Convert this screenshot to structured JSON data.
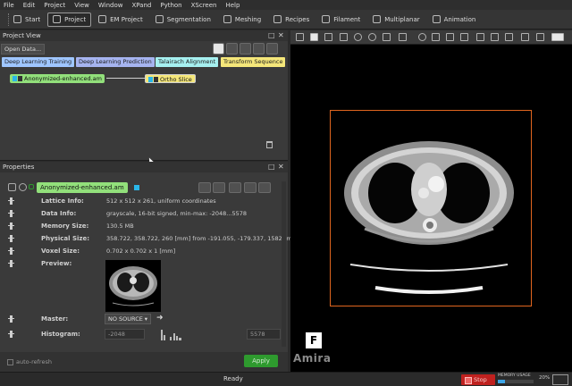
{
  "menu": [
    "File",
    "Edit",
    "Project",
    "View",
    "Window",
    "XPand",
    "Python",
    "XScreen",
    "Help"
  ],
  "workrooms": [
    {
      "label": "Start",
      "icon": "home-icon",
      "active": false
    },
    {
      "label": "Project",
      "icon": "project-icon",
      "active": true
    },
    {
      "label": "EM Project",
      "icon": "em-project-icon",
      "active": false
    },
    {
      "label": "Segmentation",
      "icon": "segmentation-icon",
      "active": false
    },
    {
      "label": "Meshing",
      "icon": "meshing-icon",
      "active": false
    },
    {
      "label": "Recipes",
      "icon": "recipes-icon",
      "active": false
    },
    {
      "label": "Filament",
      "icon": "filament-icon",
      "active": false
    },
    {
      "label": "Multiplanar",
      "icon": "multiplanar-icon",
      "active": false
    },
    {
      "label": "Animation",
      "icon": "animation-icon",
      "active": false
    }
  ],
  "project_view": {
    "title": "Project View",
    "open_data": "Open Data...",
    "tags": [
      {
        "label": "Deep Learning Training",
        "color": "#9fc6ff"
      },
      {
        "label": "Deep Learning Prediction",
        "color": "#a6b4f0"
      },
      {
        "label": "Talairach Alignment",
        "color": "#a6f0f0"
      },
      {
        "label": "Transform Sequence",
        "color": "#f5e77a"
      }
    ],
    "data_node": "Anonymized-enhanced.am",
    "data_node_color": "#92e07b",
    "module_node": "Ortho Slice",
    "module_node_color": "#f5e77a"
  },
  "properties": {
    "title": "Properties",
    "object_name": "Anonymized-enhanced.am",
    "rows": [
      {
        "label": "Lattice Info:",
        "value": "512 x 512 x 261, uniform coordinates"
      },
      {
        "label": "Data Info:",
        "value": "grayscale, 16-bit signed, min-max: -2048...5578"
      },
      {
        "label": "Memory Size:",
        "value": "130.5 MB"
      },
      {
        "label": "Physical Size:",
        "value": "358.722, 358.722, 260 [mm] from -191.055, -179.337, 1582 [m"
      },
      {
        "label": "Voxel Size:",
        "value": "0.702 x 0.702 x 1 [mm]"
      },
      {
        "label": "Preview:",
        "value": ""
      }
    ],
    "master_label": "Master:",
    "master_value": "NO SOURCE",
    "histogram_label": "Histogram:",
    "histogram_min": "-2048",
    "histogram_max": "5578",
    "auto_refresh": "auto-refresh",
    "apply": "Apply"
  },
  "viewer": {
    "brand_letter": "F",
    "brand_name": "Amira"
  },
  "statusbar": {
    "status": "Ready",
    "stop": "Stop",
    "memory_label": "MEMORY USAGE",
    "memory_fraction": 0.2,
    "cpu": "20%"
  },
  "colors": {
    "accent_green": "#2e9a2e",
    "stop_red": "#c0211f",
    "frame_orange": "#e0661f"
  }
}
